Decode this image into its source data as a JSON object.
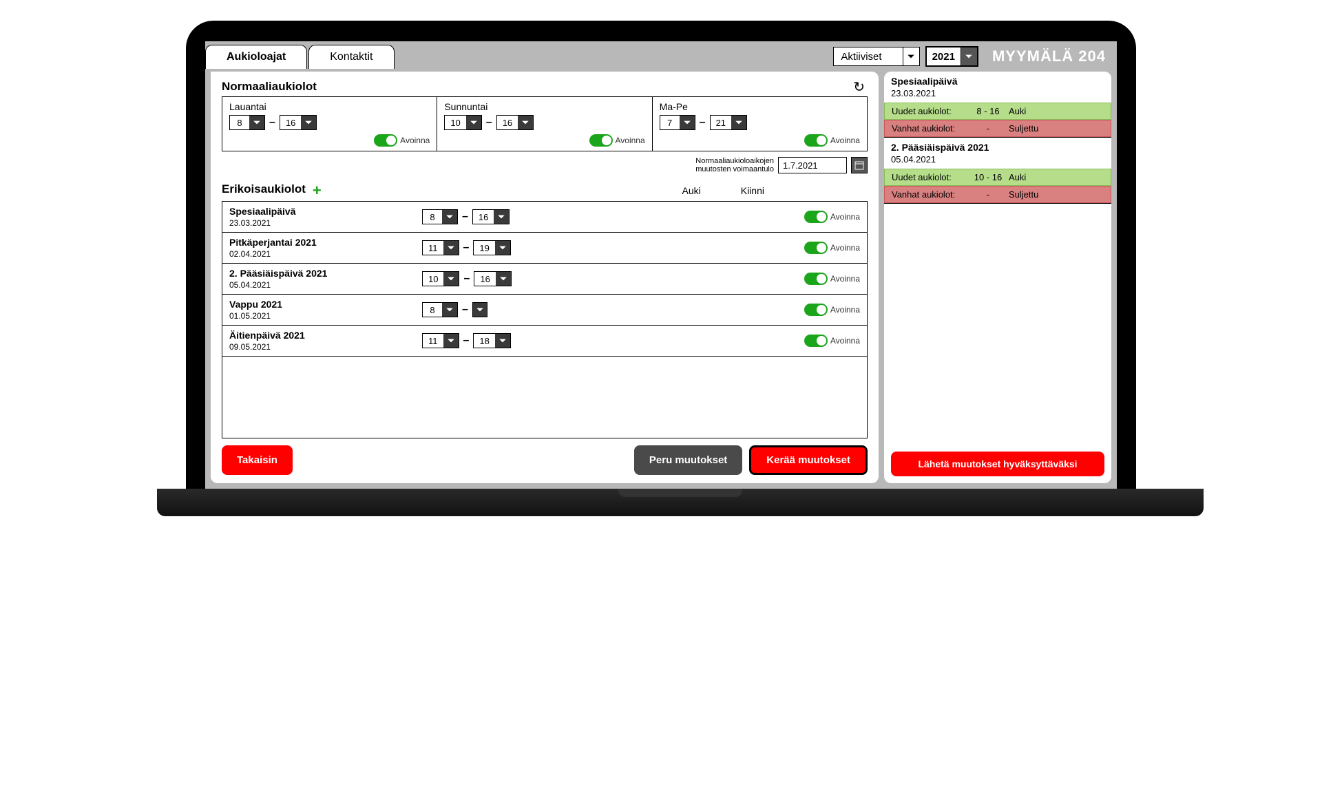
{
  "header": {
    "tabs": {
      "active": "Aukioloajat",
      "inactive": "Kontaktit"
    },
    "filter": "Aktiiviset",
    "year": "2021",
    "store": "MYYMÄLÄ 204"
  },
  "normal": {
    "title": "Normaaliaukiolot",
    "days": [
      {
        "label": "Lauantai",
        "open": "8",
        "close": "16",
        "status": "Avoinna"
      },
      {
        "label": "Sunnuntai",
        "open": "10",
        "close": "16",
        "status": "Avoinna"
      },
      {
        "label": "Ma-Pe",
        "open": "7",
        "close": "21",
        "status": "Avoinna"
      }
    ],
    "effective_label_1": "Normaaliaukioloaikojen",
    "effective_label_2": "muutosten voimaantulo",
    "effective_date": "1.7.2021"
  },
  "special": {
    "title": "Erikoisaukiolot",
    "col_open": "Auki",
    "col_close": "Kiinni",
    "rows": [
      {
        "name": "Spesiaalipäivä",
        "date": "23.03.2021",
        "open": "8",
        "close": "16",
        "status": "Avoinna"
      },
      {
        "name": "Pitkäperjantai 2021",
        "date": "02.04.2021",
        "open": "11",
        "close": "19",
        "status": "Avoinna"
      },
      {
        "name": "2. Pääsiäispäivä 2021",
        "date": "05.04.2021",
        "open": "10",
        "close": "16",
        "status": "Avoinna"
      },
      {
        "name": "Vappu 2021",
        "date": "01.05.2021",
        "open": "8",
        "close": "",
        "status": "Avoinna"
      },
      {
        "name": "Äitienpäivä 2021",
        "date": "09.05.2021",
        "open": "11",
        "close": "18",
        "status": "Avoinna"
      }
    ]
  },
  "footer": {
    "back": "Takaisin",
    "cancel": "Peru muutokset",
    "collect": "Kerää muutokset"
  },
  "side": {
    "entries": [
      {
        "name": "Spesiaalipäivä",
        "date": "23.03.2021",
        "new_label": "Uudet aukiolot:",
        "new_hours": "8 - 16",
        "new_status": "Auki",
        "old_label": "Vanhat aukiolot:",
        "old_hours": "-",
        "old_status": "Suljettu"
      },
      {
        "name": "2. Pääsiäispäivä 2021",
        "date": "05.04.2021",
        "new_label": "Uudet aukiolot:",
        "new_hours": "10 - 16",
        "new_status": "Auki",
        "old_label": "Vanhat aukiolot:",
        "old_hours": "-",
        "old_status": "Suljettu"
      }
    ],
    "submit": "Lähetä muutokset hyväksyttäväksi"
  }
}
